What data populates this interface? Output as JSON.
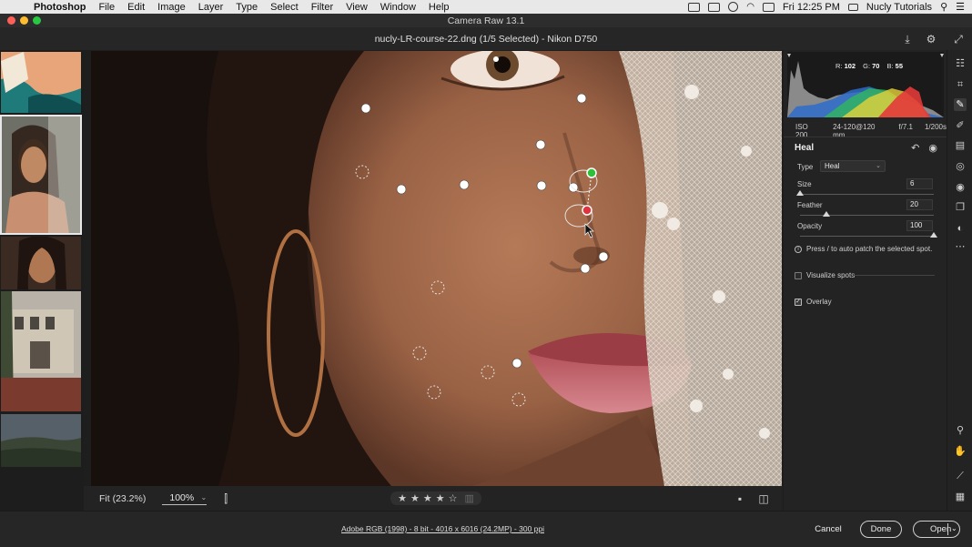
{
  "menubar": {
    "app_name": "Photoshop",
    "items": [
      "File",
      "Edit",
      "Image",
      "Layer",
      "Type",
      "Select",
      "Filter",
      "View",
      "Window",
      "Help"
    ],
    "clock": "Fri 12:25 PM",
    "user": "Nucly Tutorials"
  },
  "window": {
    "title": "Camera Raw 13.1",
    "file_header": "nucly-LR-course-22.dng (1/5 Selected)  -  Nikon D750"
  },
  "histogram": {
    "r_label": "R:",
    "r_value": "102",
    "g_label": "G:",
    "g_value": "70",
    "b_label": "B:",
    "b_value": "55"
  },
  "exif": {
    "iso": "ISO 200",
    "lens": "24-120@120 mm",
    "aperture": "f/7.1",
    "shutter": "1/200s"
  },
  "heal_panel": {
    "title": "Heal",
    "type_label": "Type",
    "type_value": "Heal",
    "size_label": "Size",
    "size_value": "6",
    "feather_label": "Feather",
    "feather_value": "20",
    "opacity_label": "Opacity",
    "opacity_value": "100",
    "size_level": 0.0,
    "feather_level": 0.2,
    "opacity_level": 1.0,
    "info_text": "Press / to auto patch the selected spot.",
    "visualize_label": "Visualize spots",
    "visualize_checked": false,
    "overlay_label": "Overlay",
    "overlay_checked": true
  },
  "canvas_toolbar": {
    "fit_label": "Fit (23.2%)",
    "zoom_value": "100%",
    "rating": 4,
    "max_rating": 5
  },
  "footer": {
    "file_info": "Adobe RGB (1998) - 8 bit - 4016 x 6016 (24.2MP) - 300 ppi",
    "cancel_label": "Cancel",
    "done_label": "Done",
    "open_label": "Open"
  },
  "colors": {
    "accent_green": "#2fbf3a",
    "accent_red": "#e0333f",
    "panel_bg": "#232323"
  }
}
